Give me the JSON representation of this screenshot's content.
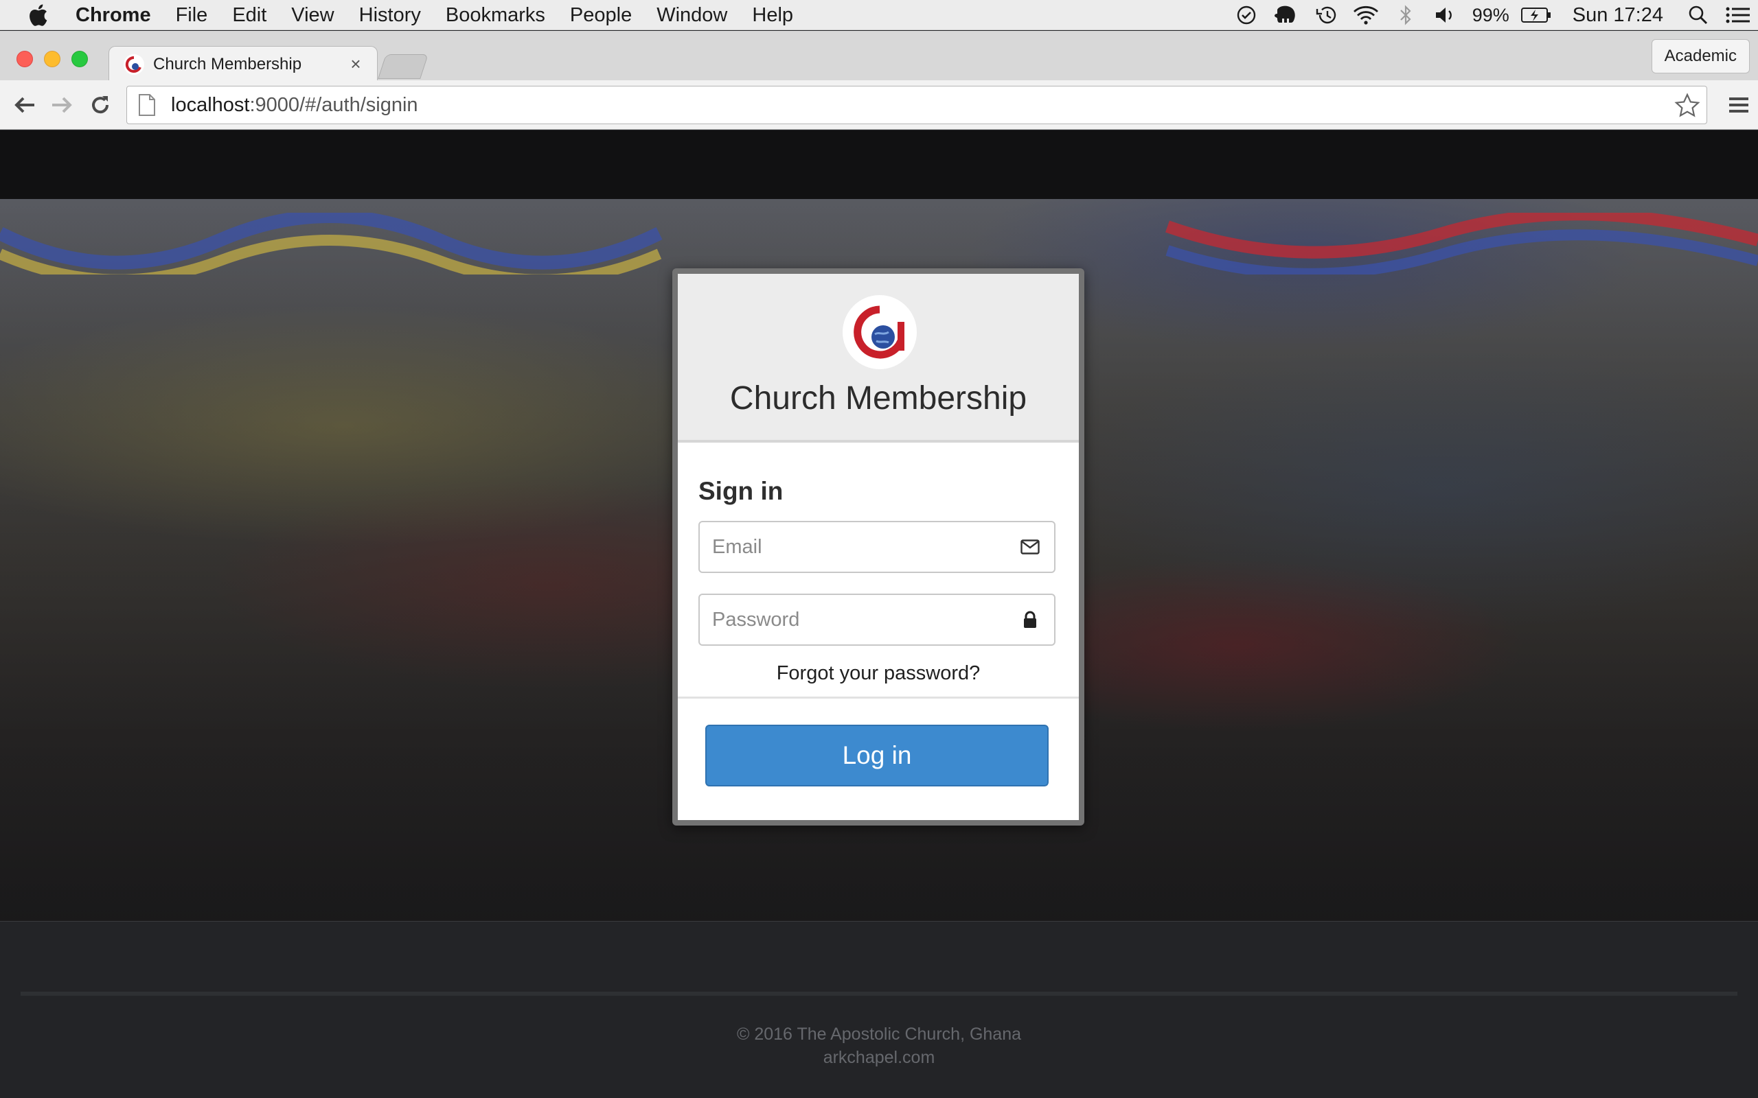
{
  "menubar": {
    "app": "Chrome",
    "items": [
      "File",
      "Edit",
      "View",
      "History",
      "Bookmarks",
      "People",
      "Window",
      "Help"
    ],
    "battery": "99%",
    "clock": "Sun 17:24"
  },
  "browser": {
    "tab_title": "Church Membership",
    "tab_close": "×",
    "profile": "Academic",
    "url_host": "localhost",
    "url_path": ":9000/#/auth/signin"
  },
  "login": {
    "brand": "Church Membership",
    "heading": "Sign in",
    "email_placeholder": "Email",
    "password_placeholder": "Password",
    "forgot": "Forgot your password?",
    "button": "Log in",
    "accent_color": "#3d8acf"
  },
  "footer": {
    "copyright": "© 2016 The Apostolic Church, Ghana",
    "site": "arkchapel.com"
  }
}
